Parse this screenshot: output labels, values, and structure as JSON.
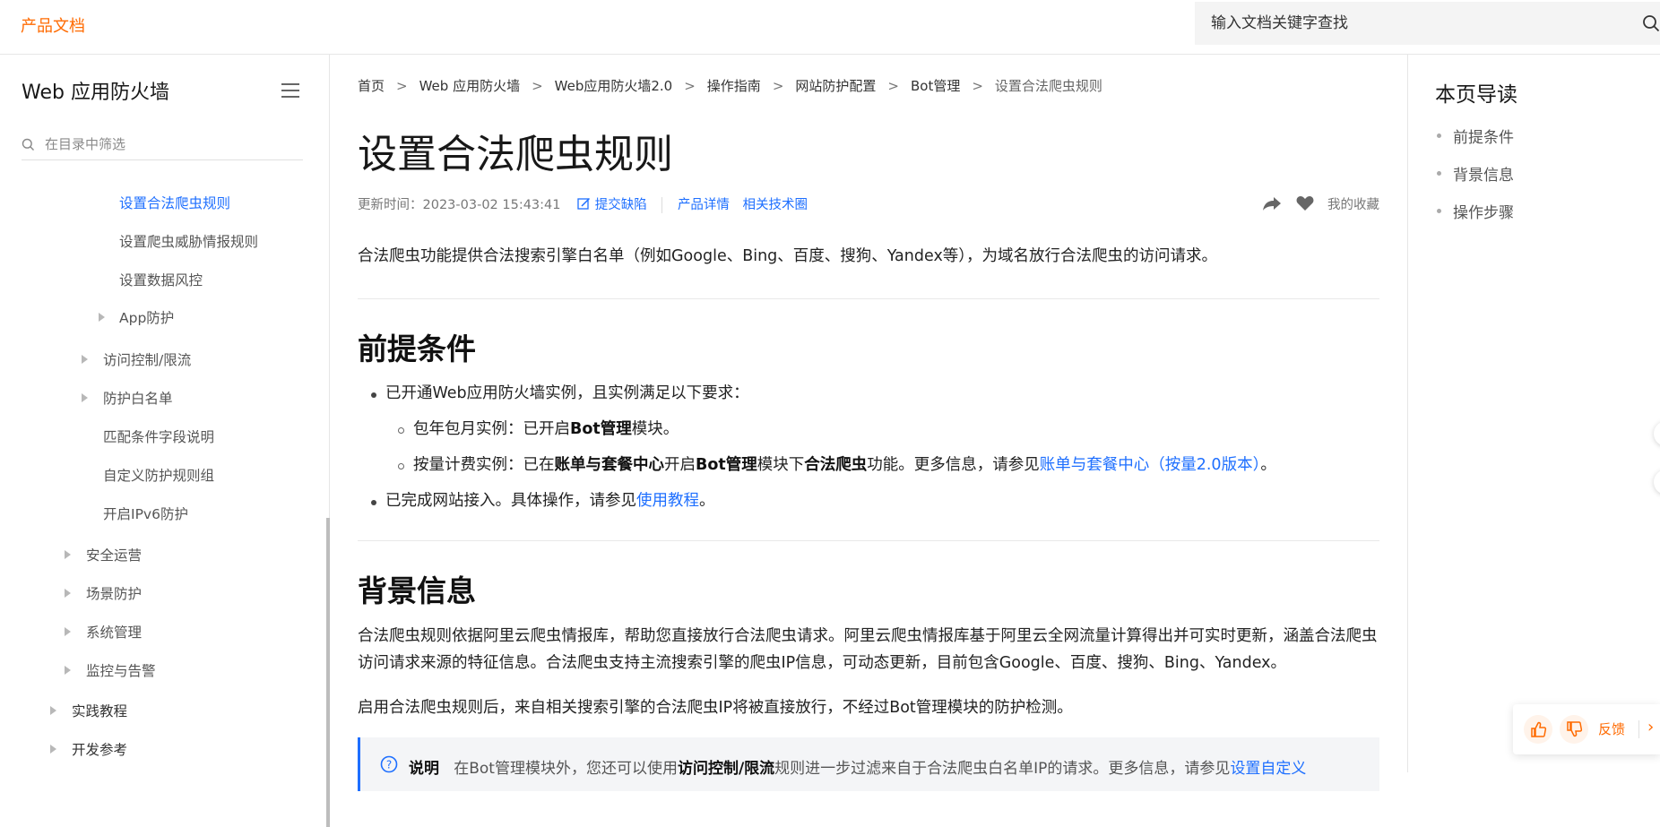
{
  "brand": "产品文档",
  "search": {
    "placeholder": "输入文档关键字查找"
  },
  "sidebar": {
    "title": "Web 应用防火墙",
    "filter_placeholder": "在目录中筛选",
    "items": [
      {
        "label": "设置合法爬虫规则",
        "active": true,
        "expandable": false
      },
      {
        "label": "设置爬虫威胁情报规则",
        "expandable": false
      },
      {
        "label": "设置数据风控",
        "expandable": false
      },
      {
        "label": "App防护",
        "expandable": true
      },
      {
        "label": "访问控制/限流",
        "expandable": true
      },
      {
        "label": "防护白名单",
        "expandable": true
      },
      {
        "label": "匹配条件字段说明",
        "expandable": false
      },
      {
        "label": "自定义防护规则组",
        "expandable": false
      },
      {
        "label": "开启IPv6防护",
        "expandable": false
      },
      {
        "label": "安全运营",
        "expandable": true
      },
      {
        "label": "场景防护",
        "expandable": true
      },
      {
        "label": "系统管理",
        "expandable": true
      },
      {
        "label": "监控与告警",
        "expandable": true
      },
      {
        "label": "实践教程",
        "expandable": true
      },
      {
        "label": "开发参考",
        "expandable": true
      }
    ]
  },
  "breadcrumb": [
    "首页",
    "Web 应用防火墙",
    "Web应用防火墙2.0",
    "操作指南",
    "网站防护配置",
    "Bot管理",
    "设置合法爬虫规则"
  ],
  "page_title": "设置合法爬虫规则",
  "meta": {
    "updated": "更新时间：2023-03-02 15:43:41",
    "report": "提交缺陷",
    "product": "产品详情",
    "community": "相关技术圈",
    "favorite": "我的收藏"
  },
  "intro": "合法爬虫功能提供合法搜索引擎白名单（例如Google、Bing、百度、搜狗、Yandex等），为域名放行合法爬虫的访问请求。",
  "sections": {
    "prereq": {
      "title": "前提条件",
      "item1": "已开通Web应用防火墙实例，且实例满足以下要求：",
      "sub1_pre": "包年包月实例：已开启",
      "sub1_bold": "Bot管理",
      "sub1_post": "模块。",
      "sub2_a": "按量计费实例：已在",
      "sub2_b": "账单与套餐中心",
      "sub2_c": "开启",
      "sub2_d": "Bot管理",
      "sub2_e": "模块下",
      "sub2_f": "合法爬虫",
      "sub2_g": "功能。更多信息，请参见",
      "sub2_link": "账单与套餐中心（按量2.0版本）",
      "sub2_end": "。",
      "item2_pre": "已完成网站接入。具体操作，请参见",
      "item2_link": "使用教程",
      "item2_end": "。"
    },
    "background": {
      "title": "背景信息",
      "para1": "合法爬虫规则依据阿里云爬虫情报库，帮助您直接放行合法爬虫请求。阿里云爬虫情报库基于阿里云全网流量计算得出并可实时更新，涵盖合法爬虫访问请求来源的特征信息。合法爬虫支持主流搜索引擎的爬虫IP信息，可动态更新，目前包含Google、百度、搜狗、Bing、Yandex。",
      "para2": "启用合法爬虫规则后，来自相关搜索引擎的合法爬虫IP将被直接放行，不经过Bot管理模块的防护检测。"
    }
  },
  "note": {
    "label": "说明",
    "text_a": "在Bot管理模块外，您还可以使用",
    "text_b": "访问控制/限流",
    "text_c": "规则进一步过滤来自于合法爬虫白名单IP的请求。更多信息，请参见",
    "link": "设置自定义"
  },
  "toc": {
    "title": "本页导读",
    "items": [
      "前提条件",
      "背景信息",
      "操作步骤"
    ]
  },
  "feedback": {
    "label": "反馈"
  }
}
